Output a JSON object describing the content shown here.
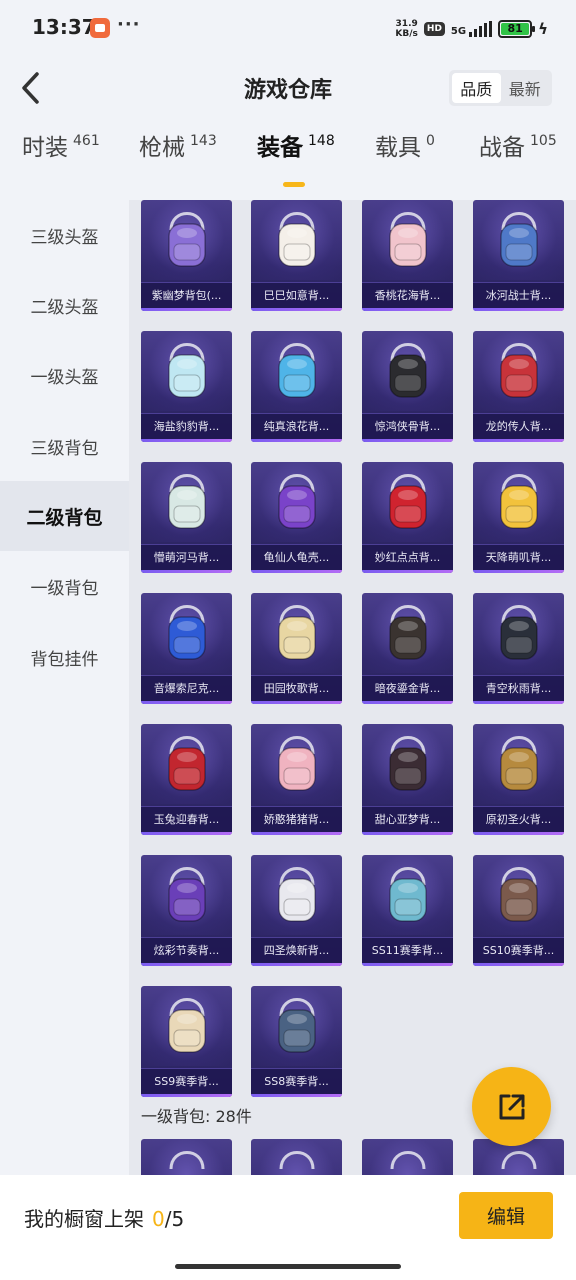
{
  "status_bar": {
    "time": "13:37",
    "more": "···",
    "speed_value": "31.9",
    "speed_unit": "KB/s",
    "hd": "HD",
    "network": "5G",
    "battery": "81"
  },
  "header": {
    "title": "游戏仓库",
    "sort_options": [
      "品质",
      "最新"
    ],
    "active_sort": "品质"
  },
  "tabs": [
    {
      "label": "时装",
      "count": "461"
    },
    {
      "label": "枪械",
      "count": "143"
    },
    {
      "label": "装备",
      "count": "148",
      "active": true
    },
    {
      "label": "载具",
      "count": "0"
    },
    {
      "label": "战备",
      "count": "105"
    }
  ],
  "sidebar": {
    "items": [
      "三级头盔",
      "二级头盔",
      "一级头盔",
      "三级背包",
      "二级背包",
      "一级背包",
      "背包挂件"
    ],
    "active": "二级背包"
  },
  "items": [
    {
      "name": "紫幽梦背包(...",
      "icon": "backpack-icon",
      "color": "#8a6fd6"
    },
    {
      "name": "巳巳如意背...",
      "icon": "backpack-icon",
      "color": "#f4efe9"
    },
    {
      "name": "香桃花海背...",
      "icon": "backpack-icon",
      "color": "#f1c4cc"
    },
    {
      "name": "冰河战士背...",
      "icon": "backpack-icon",
      "color": "#4f79c8"
    },
    {
      "name": "海盐豹豹背...",
      "icon": "backpack-icon",
      "color": "#bfe7f2"
    },
    {
      "name": "纯真浪花背...",
      "icon": "backpack-icon",
      "color": "#4fb4e8"
    },
    {
      "name": "惊鸿侠骨背...",
      "icon": "backpack-icon",
      "color": "#2b2b2f"
    },
    {
      "name": "龙的传人背...",
      "icon": "backpack-icon",
      "color": "#c8333a"
    },
    {
      "name": "懵萌河马背...",
      "icon": "backpack-icon",
      "color": "#d8e8e4"
    },
    {
      "name": "龟仙人龟壳...",
      "icon": "backpack-icon",
      "color": "#7a43c9"
    },
    {
      "name": "妙红点点背...",
      "icon": "backpack-icon",
      "color": "#d0232f"
    },
    {
      "name": "天降萌叽背...",
      "icon": "backpack-icon",
      "color": "#f2c23c"
    },
    {
      "name": "音爆索尼克...",
      "icon": "backpack-icon",
      "color": "#2e5bd6"
    },
    {
      "name": "田园牧歌背...",
      "icon": "backpack-icon",
      "color": "#e8d6a2"
    },
    {
      "name": "暗夜鎏金背...",
      "icon": "backpack-icon",
      "color": "#3a3330"
    },
    {
      "name": "青空秋雨背...",
      "icon": "backpack-icon",
      "color": "#2a2f3a"
    },
    {
      "name": "玉兔迎春背...",
      "icon": "backpack-icon",
      "color": "#c2262f"
    },
    {
      "name": "娇憨猪猪背...",
      "icon": "backpack-icon",
      "color": "#f0b3c0"
    },
    {
      "name": "甜心亚梦背...",
      "icon": "backpack-icon",
      "color": "#3b2c34"
    },
    {
      "name": "原初圣火背...",
      "icon": "backpack-icon",
      "color": "#b68a3e"
    },
    {
      "name": "炫彩节奏背...",
      "icon": "backpack-icon",
      "color": "#6a3fb8"
    },
    {
      "name": "四圣焕新背...",
      "icon": "backpack-icon",
      "color": "#e8e8ee"
    },
    {
      "name": "SS11赛季背...",
      "icon": "backpack-icon",
      "color": "#6fb9cf"
    },
    {
      "name": "SS10赛季背...",
      "icon": "backpack-icon",
      "color": "#7b5a4c"
    },
    {
      "name": "SS9赛季背...",
      "icon": "backpack-icon",
      "color": "#e9d8b8"
    },
    {
      "name": "SS8赛季背...",
      "icon": "backpack-icon",
      "color": "#4a6283"
    }
  ],
  "next_section": {
    "title": "一级背包: 28件"
  },
  "bottom_bar": {
    "label": "我的橱窗上架",
    "current": "0",
    "total": "/5",
    "edit_label": "编辑"
  },
  "fab": {
    "icon": "share-icon"
  }
}
